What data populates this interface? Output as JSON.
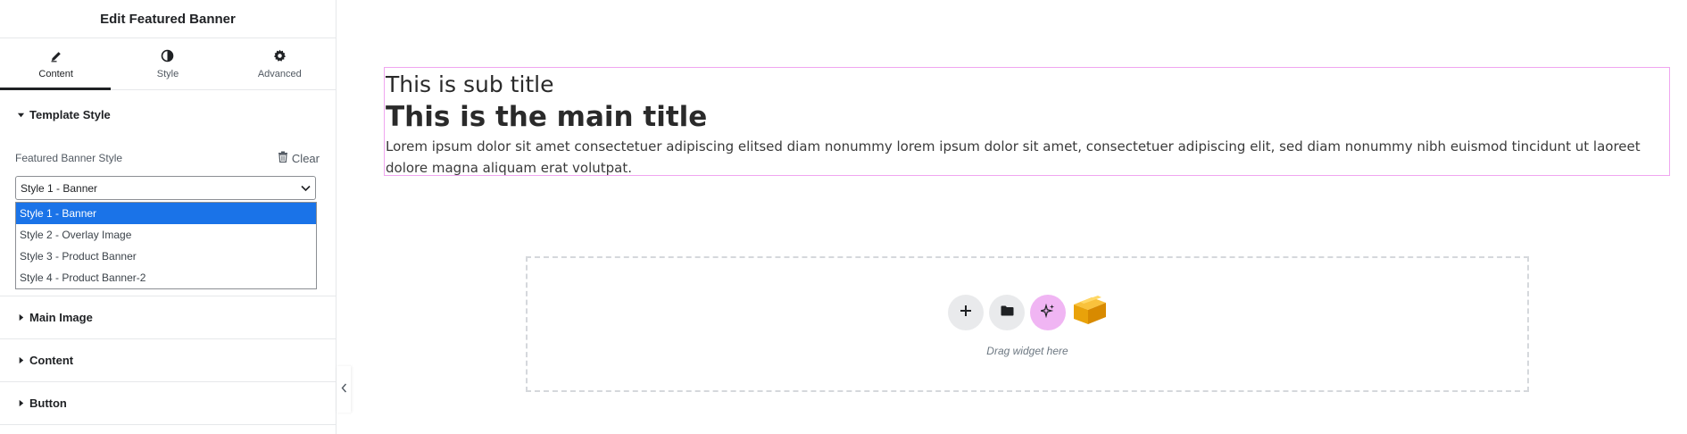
{
  "panel": {
    "title": "Edit Featured Banner",
    "tabs": [
      {
        "label": "Content",
        "icon": "pencil-icon",
        "active": true
      },
      {
        "label": "Style",
        "icon": "half-circle-icon",
        "active": false
      },
      {
        "label": "Advanced",
        "icon": "gear-icon",
        "active": false
      }
    ],
    "template_section": {
      "label": "Template Style",
      "control_label": "Featured Banner Style",
      "clear_label": "Clear",
      "selected_value": "Style 1 - Banner",
      "options": [
        "Style 1 - Banner",
        "Style 2 - Overlay Image",
        "Style 3 - Product Banner",
        "Style 4 - Product Banner-2"
      ]
    },
    "sections": [
      {
        "label": "Main Image"
      },
      {
        "label": "Content"
      },
      {
        "label": "Button"
      }
    ]
  },
  "banner": {
    "sub_title": "This is sub title",
    "main_title": "This is the main title",
    "description": "Lorem ipsum dolor sit amet consectetuer adipiscing elitsed diam nonummy lorem ipsum dolor sit amet, consectetuer adipiscing elit, sed diam nonummy nibh euismod tincidunt ut laoreet dolore magna aliquam erat volutpat."
  },
  "drop_zone": {
    "text": "Drag widget here",
    "buttons": [
      "add-icon",
      "folder-icon",
      "sparkle-icon",
      "box-icon"
    ]
  },
  "colors": {
    "accent_selected": "#1a73e8",
    "banner_outline": "#f0a6f0",
    "ai_button": "#f0b5f3"
  }
}
